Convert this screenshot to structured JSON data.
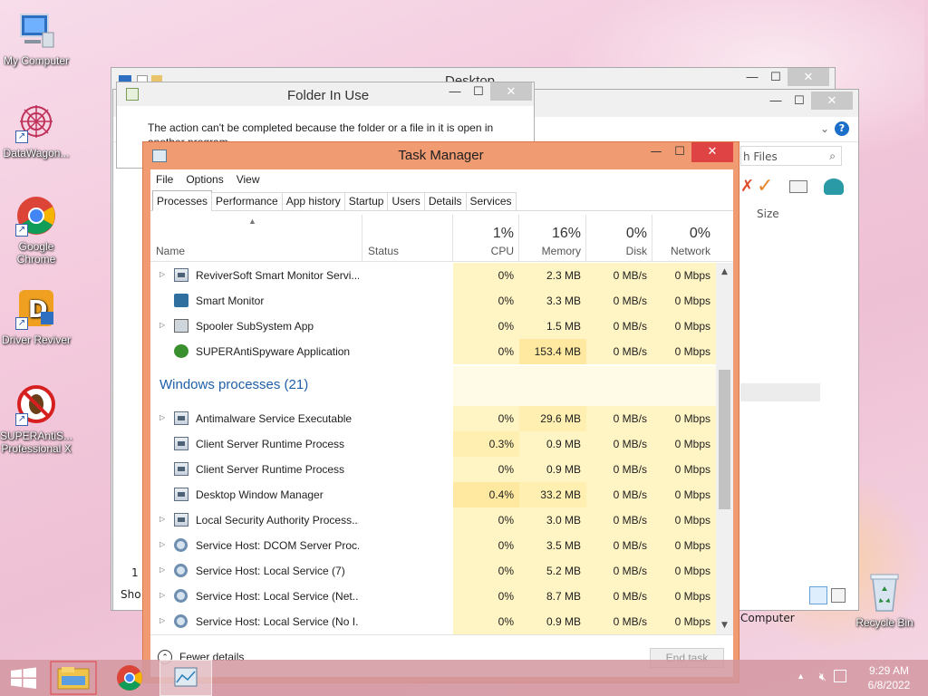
{
  "desktop": {
    "icons": [
      {
        "label": "My Computer"
      },
      {
        "label": "DataWagon..."
      },
      {
        "label": "Google Chrome"
      },
      {
        "label": "Driver Reviver"
      },
      {
        "label": "SUPERAntiS... Professional X"
      },
      {
        "label": "Recycle Bin"
      }
    ]
  },
  "explorer_back": {
    "title": "Desktop"
  },
  "explorer_front": {
    "search_placeholder": "h Files",
    "col_size": "Size",
    "status_left": "1",
    "status_short": "Sho",
    "computer_label": "Computer"
  },
  "folder_in_use": {
    "title": "Folder In Use",
    "message": "The action can't be completed because the folder or a file in it is open in another program"
  },
  "task_manager": {
    "title": "Task Manager",
    "menu": [
      "File",
      "Options",
      "View"
    ],
    "tabs": [
      "Processes",
      "Performance",
      "App history",
      "Startup",
      "Users",
      "Details",
      "Services"
    ],
    "columns": {
      "name": "Name",
      "status": "Status",
      "cpu": {
        "label": "CPU",
        "pct": "1%"
      },
      "memory": {
        "label": "Memory",
        "pct": "16%"
      },
      "disk": {
        "label": "Disk",
        "pct": "0%"
      },
      "network": {
        "label": "Network",
        "pct": "0%"
      }
    },
    "app_rows": [
      {
        "name": "ReviverSoft Smart Monitor Servi...",
        "expandable": true,
        "icon": "generic",
        "cpu": "0%",
        "memory": "2.3 MB",
        "disk": "0 MB/s",
        "network": "0 Mbps"
      },
      {
        "name": "Smart Monitor",
        "expandable": false,
        "icon": "monitor",
        "cpu": "0%",
        "memory": "3.3 MB",
        "disk": "0 MB/s",
        "network": "0 Mbps"
      },
      {
        "name": "Spooler SubSystem App",
        "expandable": true,
        "icon": "printer",
        "cpu": "0%",
        "memory": "1.5 MB",
        "disk": "0 MB/s",
        "network": "0 Mbps"
      },
      {
        "name": "SUPERAntiSpyware Application",
        "expandable": false,
        "icon": "bug",
        "cpu": "0%",
        "memory": "153.4 MB",
        "disk": "0 MB/s",
        "network": "0 Mbps"
      }
    ],
    "windows_group": "Windows processes (21)",
    "windows_rows": [
      {
        "name": "Antimalware Service Executable",
        "expandable": true,
        "icon": "generic",
        "cpu": "0%",
        "memory": "29.6 MB",
        "disk": "0 MB/s",
        "network": "0 Mbps"
      },
      {
        "name": "Client Server Runtime Process",
        "expandable": false,
        "icon": "generic",
        "cpu": "0.3%",
        "memory": "0.9 MB",
        "disk": "0 MB/s",
        "network": "0 Mbps"
      },
      {
        "name": "Client Server Runtime Process",
        "expandable": false,
        "icon": "generic",
        "cpu": "0%",
        "memory": "0.9 MB",
        "disk": "0 MB/s",
        "network": "0 Mbps"
      },
      {
        "name": "Desktop Window Manager",
        "expandable": false,
        "icon": "generic",
        "cpu": "0.4%",
        "memory": "33.2 MB",
        "disk": "0 MB/s",
        "network": "0 Mbps"
      },
      {
        "name": "Local Security Authority Process...",
        "expandable": true,
        "icon": "generic",
        "cpu": "0%",
        "memory": "3.0 MB",
        "disk": "0 MB/s",
        "network": "0 Mbps"
      },
      {
        "name": "Service Host: DCOM Server Proc...",
        "expandable": true,
        "icon": "gear",
        "cpu": "0%",
        "memory": "3.5 MB",
        "disk": "0 MB/s",
        "network": "0 Mbps"
      },
      {
        "name": "Service Host: Local Service (7)",
        "expandable": true,
        "icon": "gear",
        "cpu": "0%",
        "memory": "5.2 MB",
        "disk": "0 MB/s",
        "network": "0 Mbps"
      },
      {
        "name": "Service Host: Local Service (Net...",
        "expandable": true,
        "icon": "gear",
        "cpu": "0%",
        "memory": "8.7 MB",
        "disk": "0 MB/s",
        "network": "0 Mbps"
      },
      {
        "name": "Service Host: Local Service (No I...",
        "expandable": true,
        "icon": "gear",
        "cpu": "0%",
        "memory": "0.9 MB",
        "disk": "0 MB/s",
        "network": "0 Mbps"
      }
    ],
    "fewer_details": "Fewer details",
    "end_task": "End task"
  },
  "taskbar": {
    "time": "9:29 AM",
    "date": "6/8/2022"
  },
  "colors": {
    "tm_frame": "#f09b72",
    "close_red": "#e04343",
    "group_blue": "#1f5fa8",
    "heat_light": "#fff4c4"
  }
}
